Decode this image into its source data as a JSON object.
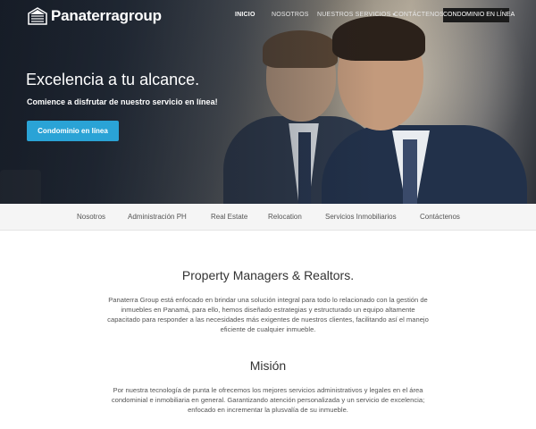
{
  "brand": {
    "name": "Panaterragroup"
  },
  "topnav": {
    "items": [
      {
        "label": "INICIO",
        "active": true
      },
      {
        "label": "NOSOTROS",
        "active": false
      },
      {
        "label": "NUESTROS SERVICIOS",
        "active": false,
        "has_dropdown": true
      },
      {
        "label": "CONTÁCTENOS",
        "active": false
      }
    ],
    "cta_label": "CONDOMINIO EN LÍNEA",
    "caret_icon": "chevron-down-icon"
  },
  "hero": {
    "title": "Excelencia a tu alcance.",
    "subtitle": "Comience a disfrutar de nuestro servicio en línea!",
    "button_label": "Condominio en línea"
  },
  "subnav": {
    "items": [
      {
        "label": "Nosotros"
      },
      {
        "label": "Administración PH"
      },
      {
        "label": "Real Estate"
      },
      {
        "label": "Relocation"
      },
      {
        "label": "Servicios Inmobiliarios"
      },
      {
        "label": "Contáctenos"
      }
    ]
  },
  "content": {
    "intro": {
      "title": "Property Managers & Realtors.",
      "text": "Panaterra Group está enfocado en brindar una solución integral para todo lo relacionado con la gestión de inmuebles en Panamá, para ello, hemos diseñado estrategias y estructurado un equipo altamente capacitado para responder a las necesidades más exigentes de nuestros clientes, facilitando así el manejo eficiente de cualquier inmueble."
    },
    "mission": {
      "title": "Misión",
      "text": "Por nuestra tecnología de punta le ofrecemos los mejores servicios administrativos y legales en el área condominial e inmobiliaria en general. Garantizando atención personalizada y un servicio de excelencia; enfocado en incrementar la plusvalía de su inmueble."
    }
  },
  "colors": {
    "accent": "#2aa3d6",
    "cta_dark": "#1b1b1b",
    "subnav_bg": "#f5f5f5"
  }
}
